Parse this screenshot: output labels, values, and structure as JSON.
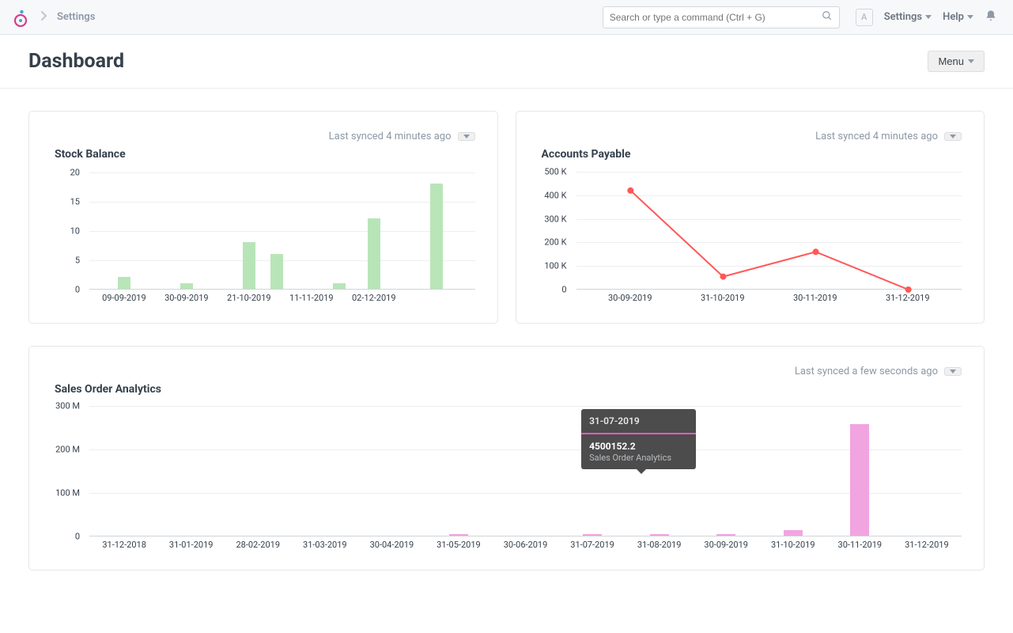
{
  "header": {
    "breadcrumb": "Settings",
    "search_placeholder": "Search or type a command (Ctrl + G)",
    "avatar_letter": "A",
    "settings_label": "Settings",
    "help_label": "Help"
  },
  "page": {
    "title": "Dashboard",
    "menu_label": "Menu"
  },
  "cards": {
    "stock": {
      "title": "Stock Balance",
      "synced": "Last synced 4 minutes ago"
    },
    "payable": {
      "title": "Accounts Payable",
      "synced": "Last synced 4 minutes ago"
    },
    "sales": {
      "title": "Sales Order Analytics",
      "synced": "Last synced a few seconds ago"
    }
  },
  "tooltip": {
    "date": "31-07-2019",
    "value": "4500152.2",
    "label": "Sales Order Analytics"
  },
  "chart_data": [
    {
      "type": "bar",
      "title": "Stock Balance",
      "categories": [
        "09-09-2019",
        "30-09-2019",
        "21-10-2019",
        "11-11-2019",
        "02-12-2019"
      ],
      "y_ticks": [
        0,
        5,
        10,
        15,
        20
      ],
      "y_tick_labels": [
        "0",
        "5",
        "10",
        "15",
        "20"
      ],
      "ylim": [
        0,
        21
      ],
      "bar_color": "#b8e5b8",
      "series": [
        {
          "name": "Stock Balance",
          "values": [
            2,
            0,
            1,
            0,
            8,
            6,
            0,
            1,
            12,
            0,
            18,
            0
          ]
        }
      ],
      "x_positions_pct": [
        10,
        18,
        28,
        36,
        46,
        54,
        64,
        72,
        82,
        90,
        100,
        108
      ],
      "x_label_positions_pct": [
        10,
        28,
        46,
        64,
        82,
        100
      ],
      "hidden_last": true
    },
    {
      "type": "line",
      "title": "Accounts Payable",
      "categories": [
        "30-09-2019",
        "31-10-2019",
        "30-11-2019",
        "31-12-2019"
      ],
      "y_ticks": [
        0,
        100000,
        200000,
        300000,
        400000,
        500000
      ],
      "y_tick_labels": [
        "0",
        "100 K",
        "200 K",
        "300 K",
        "400 K",
        "500 K"
      ],
      "ylim": [
        0,
        520000
      ],
      "line_color": "#ff5858",
      "series": [
        {
          "name": "Accounts Payable",
          "values": [
            420000,
            55000,
            160000,
            0
          ]
        }
      ]
    },
    {
      "type": "bar",
      "title": "Sales Order Analytics",
      "categories": [
        "31-12-2018",
        "31-01-2019",
        "28-02-2019",
        "31-03-2019",
        "30-04-2019",
        "31-05-2019",
        "30-06-2019",
        "31-07-2019",
        "31-08-2019",
        "30-09-2019",
        "31-10-2019",
        "30-11-2019",
        "31-12-2019"
      ],
      "y_ticks": [
        0,
        100000000,
        200000000,
        300000000
      ],
      "y_tick_labels": [
        "0",
        "100 M",
        "200 M",
        "300 M"
      ],
      "ylim": [
        0,
        310000000
      ],
      "bar_color": "#f2a4e1",
      "series": [
        {
          "name": "Sales Order Analytics",
          "values": [
            0,
            0,
            0,
            0,
            0,
            3000000,
            0,
            4500152.2,
            2000000,
            2000000,
            12000000,
            258000000,
            0
          ]
        }
      ]
    }
  ]
}
